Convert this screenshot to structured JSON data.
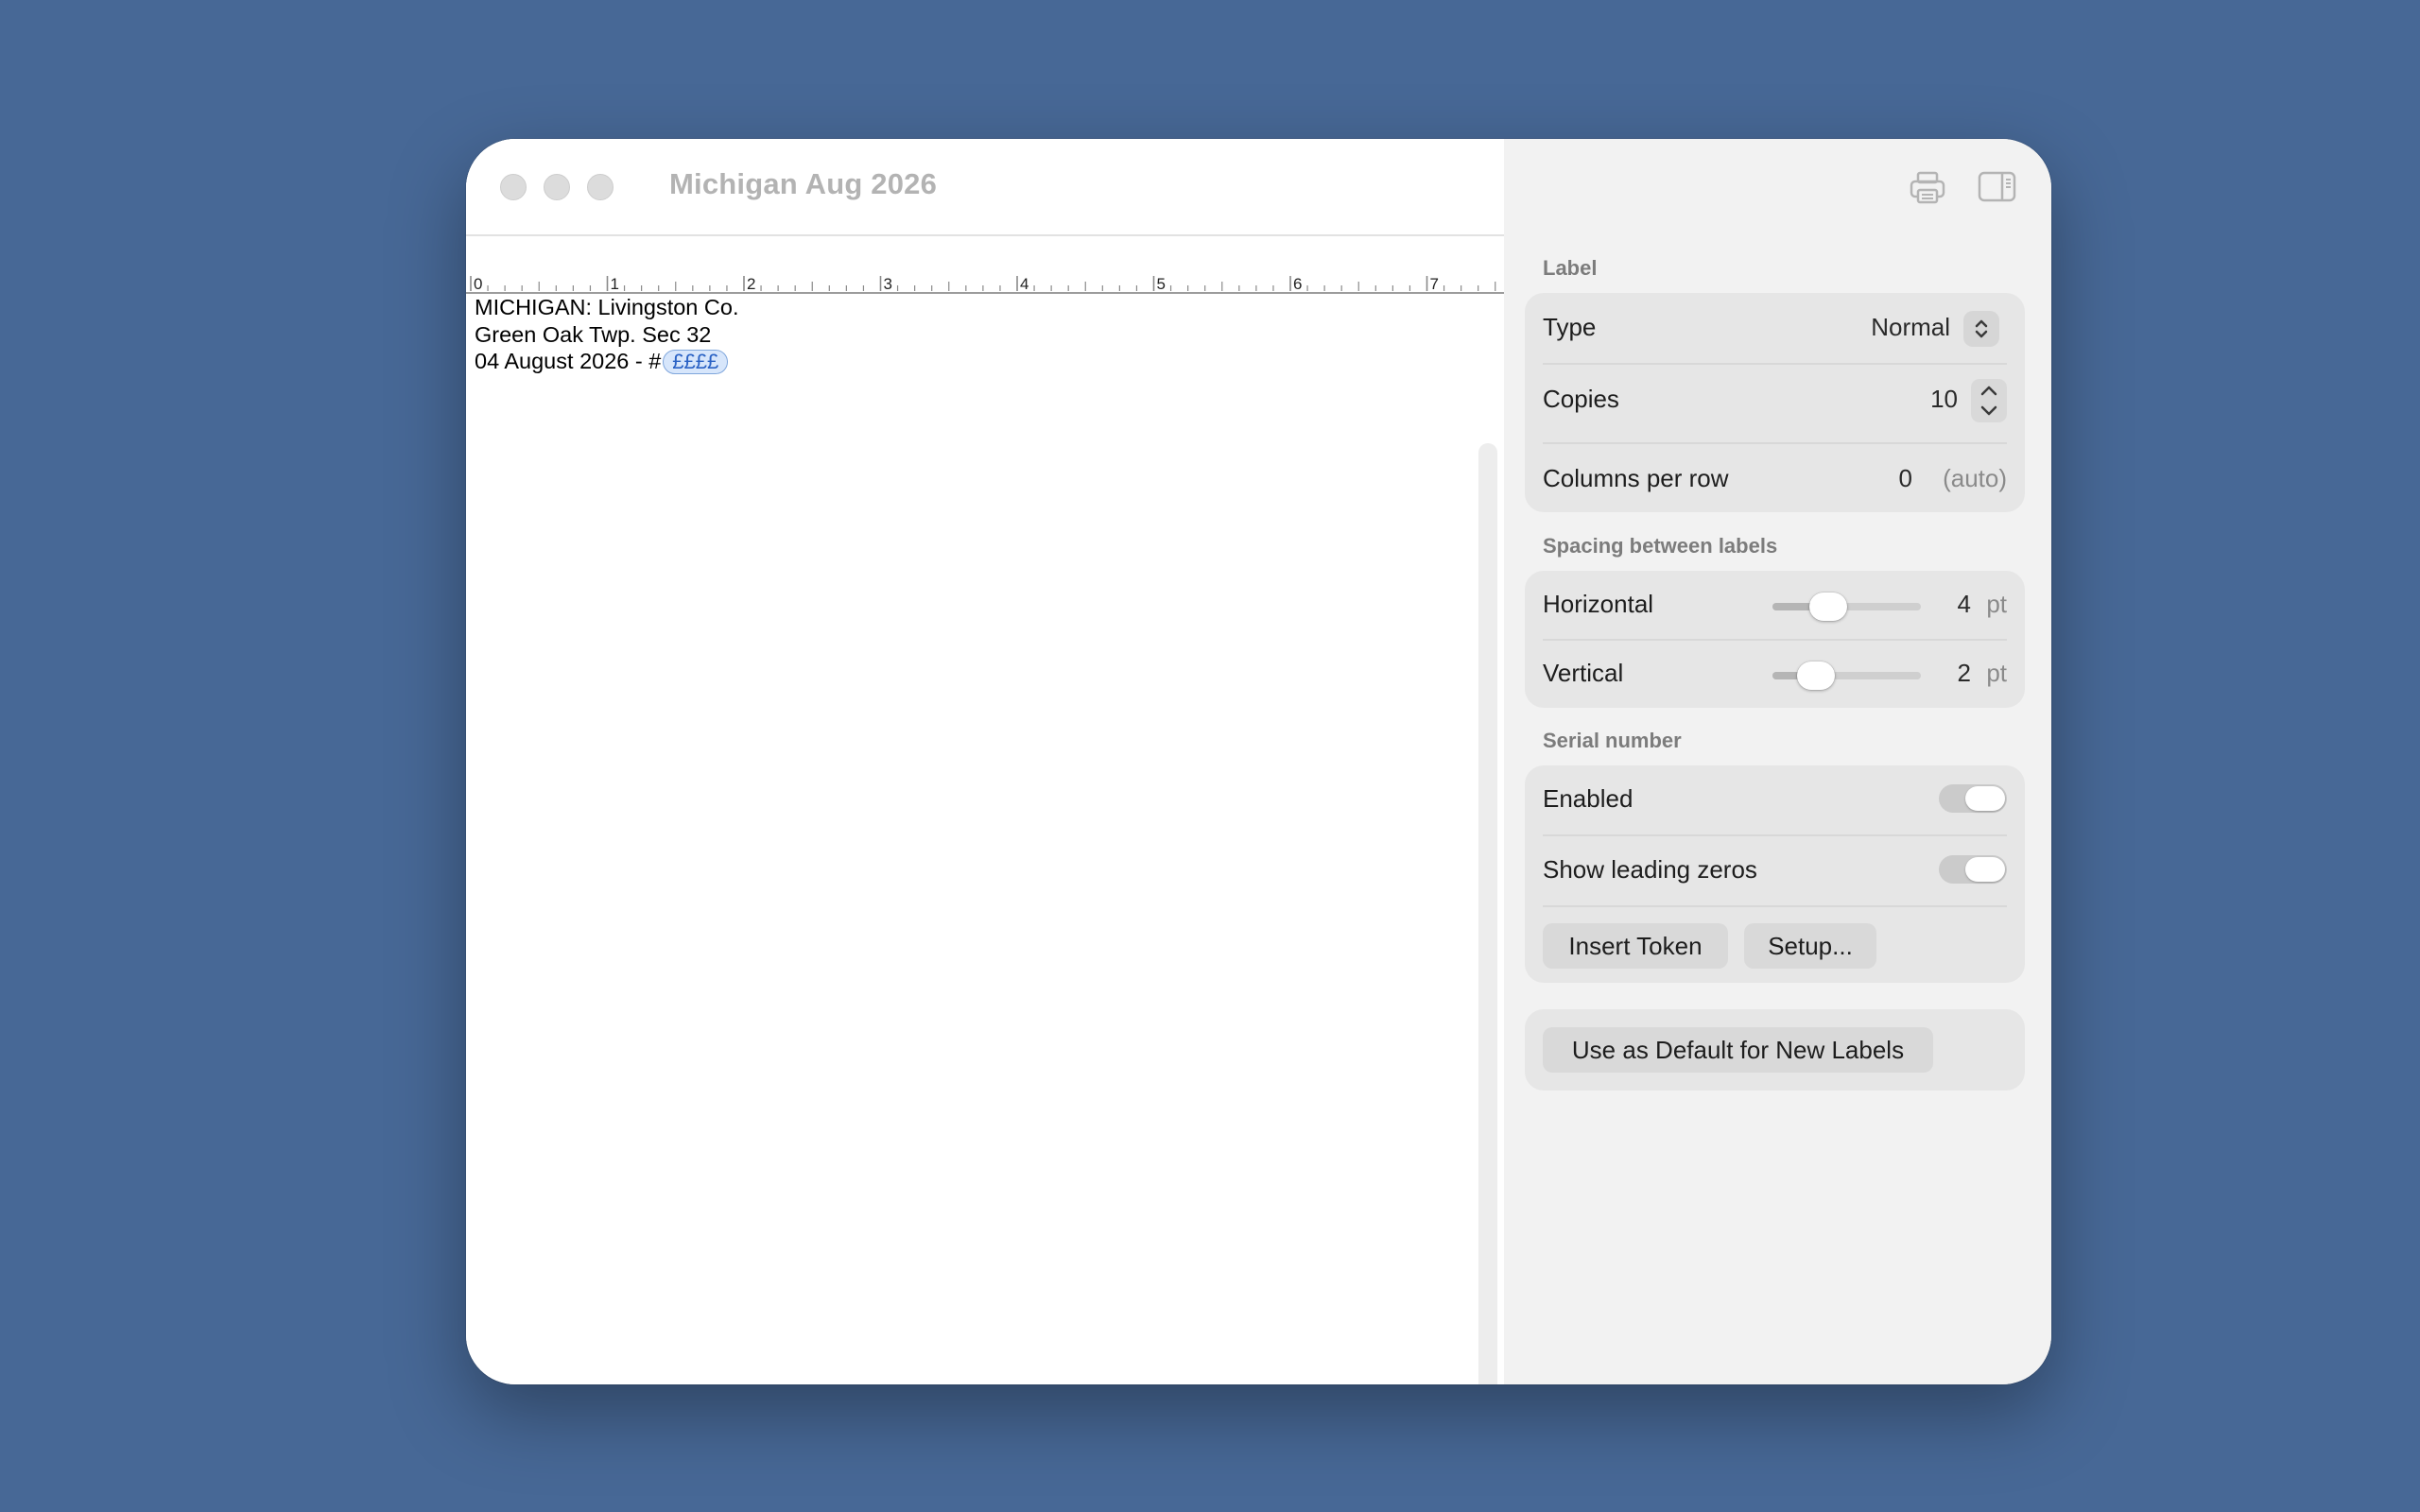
{
  "window": {
    "title": "Michigan Aug 2026"
  },
  "ruler": {
    "labels": [
      "0",
      "1",
      "2",
      "3",
      "4",
      "5",
      "6",
      "7"
    ]
  },
  "document": {
    "lines": [
      "MICHIGAN: Livingston Co.",
      "Green Oak Twp. Sec 32",
      "04 August 2026 - #"
    ],
    "token": "££££"
  },
  "inspector": {
    "label_section": {
      "heading": "Label",
      "type_label": "Type",
      "type_value": "Normal",
      "copies_label": "Copies",
      "copies_value": "10",
      "columns_label": "Columns per row",
      "columns_value": "0",
      "columns_hint": "(auto)"
    },
    "spacing_section": {
      "heading": "Spacing between labels",
      "horizontal_label": "Horizontal",
      "horizontal_value": "4",
      "horizontal_unit": "pt",
      "horizontal_level": 0.33,
      "vertical_label": "Vertical",
      "vertical_value": "2",
      "vertical_unit": "pt",
      "vertical_level": 0.22
    },
    "serial_section": {
      "heading": "Serial number",
      "enabled_label": "Enabled",
      "enabled_on": false,
      "leading_zeros_label": "Show leading zeros",
      "leading_zeros_on": false,
      "insert_token_label": "Insert Token",
      "setup_label": "Setup..."
    },
    "default_button_label": "Use as Default for New Labels"
  },
  "icons": {
    "print": "printer-icon",
    "sidebar": "sidebar-toggle-icon",
    "type_popup": "chevron-up-down-icon",
    "stepper_up": "chevron-up-icon",
    "stepper_down": "chevron-down-icon"
  },
  "colors": {
    "desktop": "#476896",
    "token_bg": "#d7e6fb",
    "token_text": "#2a62c4",
    "inspector_bg": "#f2f2f2",
    "group_bg": "#e6e6e6"
  }
}
